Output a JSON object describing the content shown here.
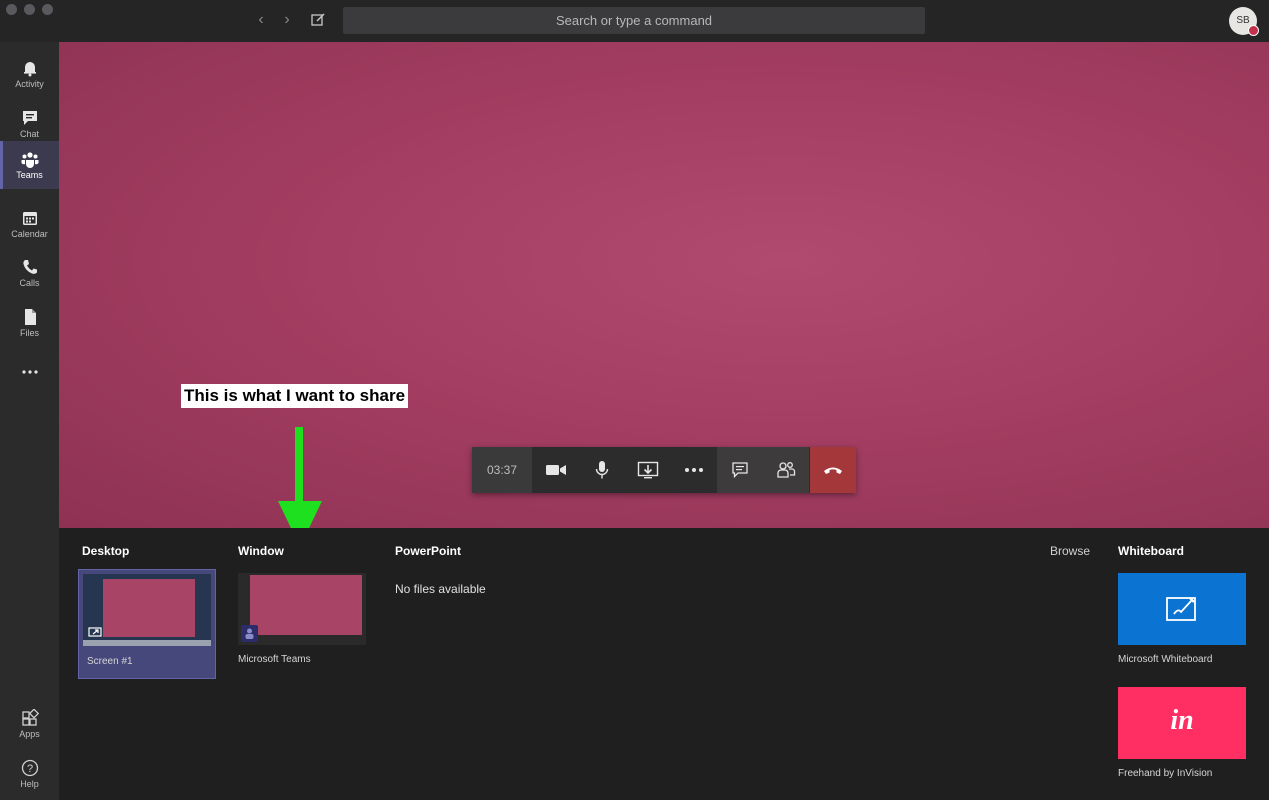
{
  "titlebar": {
    "search_placeholder": "Search or type a command",
    "avatar_initials": "SB"
  },
  "rail": {
    "items": [
      {
        "label": "Activity",
        "icon": "bell-icon"
      },
      {
        "label": "Chat",
        "icon": "chat-icon"
      },
      {
        "label": "Teams",
        "icon": "teams-icon",
        "active": true
      },
      {
        "label": "Calendar",
        "icon": "calendar-icon"
      },
      {
        "label": "Calls",
        "icon": "phone-icon"
      },
      {
        "label": "Files",
        "icon": "file-icon"
      }
    ],
    "bottom": [
      {
        "label": "Apps",
        "icon": "apps-icon"
      },
      {
        "label": "Help",
        "icon": "help-icon"
      }
    ]
  },
  "stage": {
    "annotation": "This is what I want to share",
    "arrow_color": "#1ee01e"
  },
  "callbar": {
    "timer": "03:37",
    "hangup_color": "#a4373a"
  },
  "share": {
    "desktop": {
      "title": "Desktop",
      "screen_label": "Screen #1"
    },
    "window": {
      "title": "Window",
      "item_label": "Microsoft Teams"
    },
    "powerpoint": {
      "title": "PowerPoint",
      "empty": "No files available",
      "browse": "Browse"
    },
    "whiteboard": {
      "title": "Whiteboard",
      "items": [
        {
          "label": "Microsoft Whiteboard",
          "color": "#0b73d1"
        },
        {
          "label": "Freehand by InVision",
          "glyph": "in",
          "color": "#ff2f64"
        }
      ]
    }
  },
  "colors": {
    "accent": "#6264a7",
    "stage": "#a43e62"
  }
}
